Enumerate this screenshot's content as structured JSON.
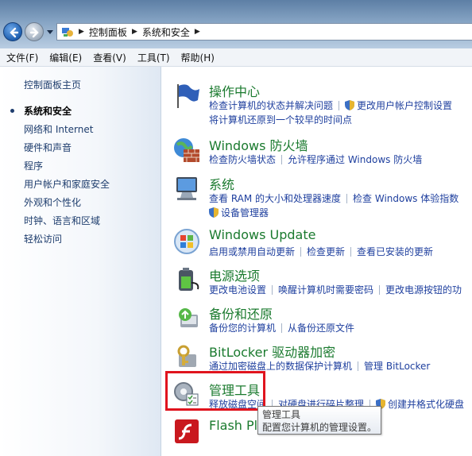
{
  "address": {
    "crumbs": [
      "控制面板",
      "系统和安全"
    ]
  },
  "menu": [
    "文件(F)",
    "编辑(E)",
    "查看(V)",
    "工具(T)",
    "帮助(H)"
  ],
  "leftnav": [
    {
      "label": "控制面板主页",
      "current": false
    },
    {
      "label": "系统和安全",
      "current": true
    },
    {
      "label": "网络和 Internet",
      "current": false
    },
    {
      "label": "硬件和声音",
      "current": false
    },
    {
      "label": "程序",
      "current": false
    },
    {
      "label": "用户帐户和家庭安全",
      "current": false
    },
    {
      "label": "外观和个性化",
      "current": false
    },
    {
      "label": "时钟、语言和区域",
      "current": false
    },
    {
      "label": "轻松访问",
      "current": false
    }
  ],
  "categories": [
    {
      "title": "操作中心",
      "icon": "flag-icon",
      "links": [
        "检查计算机的状态并解决问题",
        "更改用户帐户控制设置"
      ],
      "links2": [
        "将计算机还原到一个较早的时间点"
      ]
    },
    {
      "title": "Windows 防火墙",
      "icon": "firewall-icon",
      "links": [
        "检查防火墙状态",
        "允许程序通过 Windows 防火墙"
      ]
    },
    {
      "title": "系统",
      "icon": "computer-icon",
      "links": [
        "查看 RAM 的大小和处理器速度",
        "检查 Windows 体验指数"
      ],
      "links2": [
        "设备管理器"
      ]
    },
    {
      "title": "Windows Update",
      "icon": "windows-update-icon",
      "links": [
        "启用或禁用自动更新",
        "检查更新",
        "查看已安装的更新"
      ]
    },
    {
      "title": "电源选项",
      "icon": "battery-icon",
      "links": [
        "更改电池设置",
        "唤醒计算机时需要密码",
        "更改电源按钮的功"
      ]
    },
    {
      "title": "备份和还原",
      "icon": "backup-icon",
      "links": [
        "备份您的计算机",
        "从备份还原文件"
      ]
    },
    {
      "title": "BitLocker 驱动器加密",
      "icon": "bitlocker-icon",
      "links": [
        "通过加密磁盘上的数据保护计算机",
        "管理 BitLocker"
      ]
    },
    {
      "title": "管理工具",
      "icon": "admin-tools-icon",
      "links": [
        "释放磁盘空间",
        "对硬盘进行碎片整理",
        "创建并格式化硬盘"
      ]
    },
    {
      "title": "Flash Pl",
      "icon": "flash-icon",
      "links": []
    }
  ],
  "tooltip": {
    "line1": "管理工具",
    "line2": "配置您计算机的管理设置。"
  }
}
